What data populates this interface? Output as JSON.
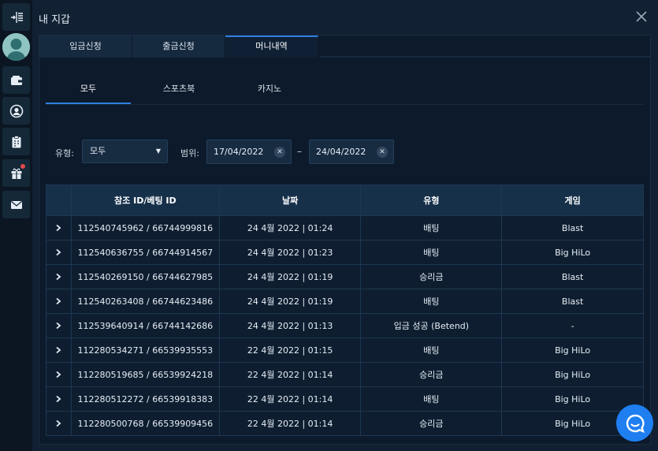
{
  "modal": {
    "title": "내 지갑",
    "tabs": [
      "입금신청",
      "출금신청",
      "머니내역"
    ],
    "active_tab": 2,
    "subtabs": [
      "모두",
      "스포츠북",
      "카지노"
    ],
    "active_subtab": 0
  },
  "filters": {
    "type_label": "유형:",
    "type_value": "모두",
    "range_label": "범위:",
    "date_from": "17/04/2022",
    "date_to": "24/04/2022",
    "separator": "–"
  },
  "table": {
    "columns": [
      "참조 ID/베팅 ID",
      "날짜",
      "유형",
      "게임"
    ],
    "rows": [
      {
        "id": "112540745962 / 66744999816",
        "date": "24 4월 2022 | 01:24",
        "type": "배팅",
        "game": "Blast"
      },
      {
        "id": "112540636755 / 66744914567",
        "date": "24 4월 2022 | 01:23",
        "type": "배팅",
        "game": "Big HiLo"
      },
      {
        "id": "112540269150 / 66744627985",
        "date": "24 4월 2022 | 01:19",
        "type": "승리금",
        "game": "Blast"
      },
      {
        "id": "112540263408 / 66744623486",
        "date": "24 4월 2022 | 01:19",
        "type": "배팅",
        "game": "Blast"
      },
      {
        "id": "112539640914 / 66744142686",
        "date": "24 4월 2022 | 01:13",
        "type": "입금 성공 (Betend)",
        "game": "-"
      },
      {
        "id": "112280534271 / 66539935553",
        "date": "22 4월 2022 | 01:15",
        "type": "배팅",
        "game": "Big HiLo"
      },
      {
        "id": "112280519685 / 66539924218",
        "date": "22 4월 2022 | 01:14",
        "type": "승리금",
        "game": "Big HiLo"
      },
      {
        "id": "112280512272 / 66539918383",
        "date": "22 4월 2022 | 01:14",
        "type": "배팅",
        "game": "Big HiLo"
      },
      {
        "id": "112280500768 / 66539909456",
        "date": "22 4월 2022 | 01:14",
        "type": "승리금",
        "game": "Big HiLo"
      }
    ]
  },
  "colors": {
    "accent": "#2f7ee0",
    "chat_button": "#1f7ff0",
    "notification": "#e24a4a"
  },
  "icons": {
    "rail": [
      "menu-collapse-icon",
      "avatar",
      "wallet-icon",
      "user-circle-icon",
      "clipboard-icon",
      "gift-icon",
      "mail-icon"
    ],
    "close": "close-icon",
    "chat": "chat-bubble-icon",
    "row_expand": "chevron-right-icon"
  }
}
